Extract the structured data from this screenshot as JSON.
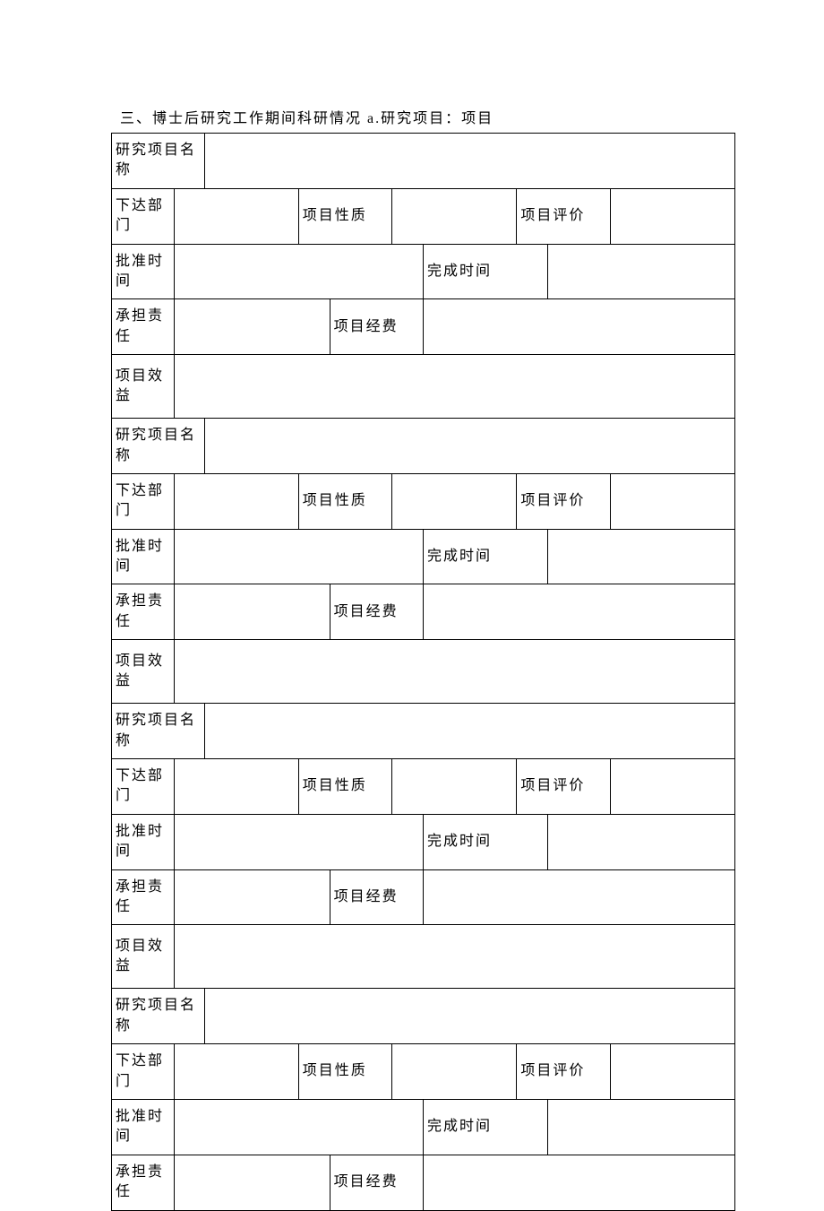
{
  "heading": "三、博士后研究工作期间科研情况 a.研究项目：项目",
  "labels": {
    "project_name": "研究项目名称",
    "issuing_dept": "下达部门",
    "project_nature": "项目性质",
    "project_eval": "项目评价",
    "approval_time": "批准时间",
    "completion_time": "完成时间",
    "responsibility": "承担责任",
    "project_funding": "项目经费",
    "project_benefit": "项目效益"
  },
  "projects": [
    {
      "name": "",
      "issuing_dept": "",
      "nature": "",
      "eval": "",
      "approval_time": "",
      "completion_time": "",
      "responsibility": "",
      "funding": "",
      "benefit": ""
    },
    {
      "name": "",
      "issuing_dept": "",
      "nature": "",
      "eval": "",
      "approval_time": "",
      "completion_time": "",
      "responsibility": "",
      "funding": "",
      "benefit": ""
    },
    {
      "name": "",
      "issuing_dept": "",
      "nature": "",
      "eval": "",
      "approval_time": "",
      "completion_time": "",
      "responsibility": "",
      "funding": "",
      "benefit": ""
    },
    {
      "name": "",
      "issuing_dept": "",
      "nature": "",
      "eval": "",
      "approval_time": "",
      "completion_time": "",
      "responsibility": "",
      "funding": ""
    }
  ]
}
